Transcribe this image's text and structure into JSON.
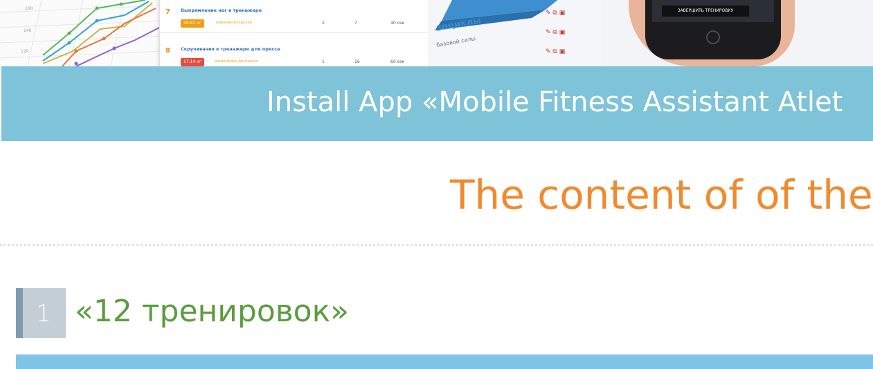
{
  "hero": {
    "exercises": [
      {
        "num": "7",
        "title": "Выпрямление ног в тренажере",
        "weight": "58.81 кг",
        "load": "тяжелая нагрузка",
        "sets": "2",
        "reps": "7",
        "rest": "40 сек"
      },
      {
        "num": "8",
        "title": "Скручивания в тренажере для пресса",
        "weight": "17.14 кг",
        "load": "выполнять до отказа",
        "sets": "1",
        "reps": "16",
        "rest": "60 сек"
      }
    ],
    "card_heading": "зоциклы",
    "card_line": "базовой силы",
    "phone_button": "ЗАВЕРШИТЬ ТРЕНИРОВКУ"
  },
  "install_banner": {
    "text": "Install App «Mobile Fitness Assistant Atlet"
  },
  "content_title": "The content of of the",
  "item": {
    "number": "1",
    "title": "«12 тренировок»"
  },
  "colors": {
    "banner": "#7ec3d8",
    "title_orange": "#f08a2e",
    "item_green": "#5c9c3f",
    "badge_gray": "#c3ced7",
    "bottom_strip": "#7fc4e7"
  }
}
